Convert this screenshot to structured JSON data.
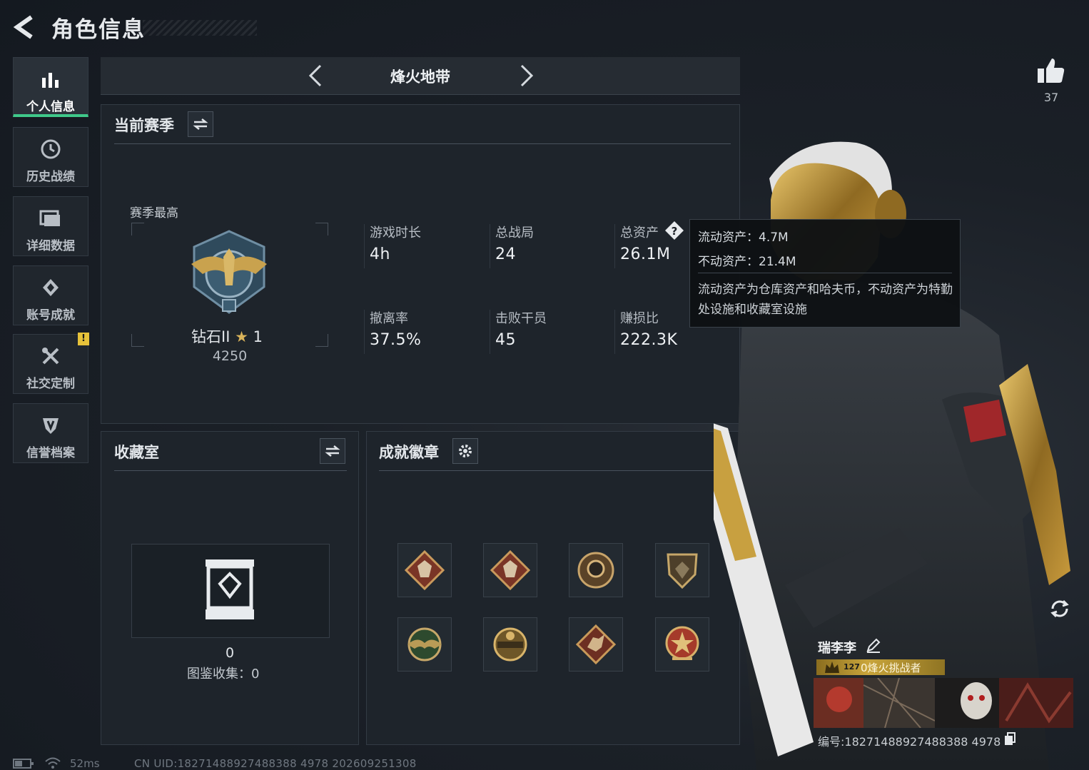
{
  "header": {
    "title": "角色信息"
  },
  "sidebar": {
    "items": [
      {
        "label": "个人信息",
        "icon": "bar-chart-icon",
        "active": true
      },
      {
        "label": "历史战绩",
        "icon": "clock-icon",
        "active": false
      },
      {
        "label": "详细数据",
        "icon": "folder-icon",
        "active": false
      },
      {
        "label": "账号成就",
        "icon": "diamond-badge-icon",
        "active": false
      },
      {
        "label": "社交定制",
        "icon": "tools-icon",
        "active": false,
        "alert": "!"
      },
      {
        "label": "信誉档案",
        "icon": "shield-icon",
        "active": false
      }
    ]
  },
  "mode": {
    "name": "烽火地带"
  },
  "season": {
    "title": "当前赛季",
    "best_label": "赛季最高",
    "rank_name": "钻石II",
    "rank_stars": "1",
    "rank_score": "4250",
    "stats": [
      {
        "label": "游戏时长",
        "value": "4h"
      },
      {
        "label": "总战局",
        "value": "24"
      },
      {
        "label": "总资产",
        "value": "26.1M"
      },
      {
        "label": "撤离率",
        "value": "37.5%"
      },
      {
        "label": "击败干员",
        "value": "45"
      },
      {
        "label": "赚损比",
        "value": "222.3K"
      }
    ]
  },
  "tooltip": {
    "liquid": "流动资产：4.7M",
    "fixed": "不动资产：21.4M",
    "desc": "流动资产为仓库资产和哈夫币，不动资产为特勤处设施和收藏室设施"
  },
  "collection": {
    "title": "收藏室",
    "count": "0",
    "label": "图鉴收集：0"
  },
  "achievements": {
    "title": "成就徽章",
    "medals": [
      {
        "icon": "wolf-diamond-medal-icon"
      },
      {
        "icon": "wolf-diamond-medal-icon"
      },
      {
        "icon": "round-bronze-medal-icon"
      },
      {
        "icon": "shield-gem-medal-icon"
      },
      {
        "icon": "green-wings-medal-icon"
      },
      {
        "icon": "gold-emblem-medal-icon"
      },
      {
        "icon": "dragon-diamond-medal-icon"
      },
      {
        "icon": "red-star-medal-icon"
      }
    ]
  },
  "profile": {
    "likes": "37",
    "name": "瑞李李",
    "title_level": "127",
    "title_text": "0烽火挑战者",
    "uid_text": "编号:18271488927488388 4978"
  },
  "status": {
    "ping": "52ms",
    "uid": "CN UID:18271488927488388 4978 202609251308"
  },
  "colors": {
    "accent": "#3fc98a",
    "gold": "#c9a53b",
    "warning": "#e6c23a"
  }
}
